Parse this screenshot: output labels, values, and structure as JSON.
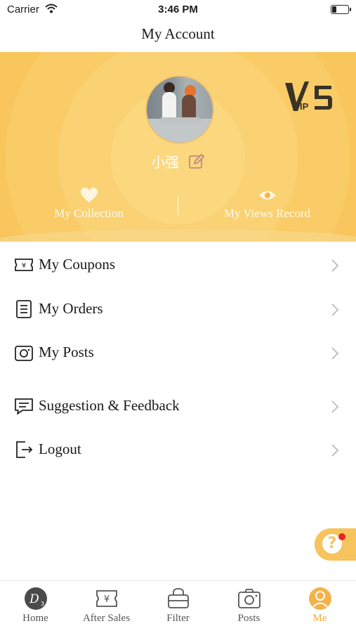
{
  "status_bar": {
    "carrier": "Carrier",
    "time": "3:46 PM"
  },
  "header": {
    "title": "My Account"
  },
  "profile": {
    "username": "小强",
    "vip_badge": "VIP5",
    "quick_links": [
      {
        "label": "My Collection",
        "icon": "heart-icon"
      },
      {
        "label": "My Views Record",
        "icon": "eye-icon"
      }
    ]
  },
  "menu": [
    {
      "label": "My Coupons",
      "icon": "coupon-icon"
    },
    {
      "label": "My Orders",
      "icon": "document-icon"
    },
    {
      "label": "My Posts",
      "icon": "camera-icon"
    },
    {
      "label": "Suggestion & Feedback",
      "icon": "chat-icon"
    },
    {
      "label": "Logout",
      "icon": "logout-icon"
    }
  ],
  "help": {
    "glyph": "?"
  },
  "tabbar": {
    "items": [
      {
        "label": "Home",
        "icon": "home-logo-icon"
      },
      {
        "label": "After Sales",
        "icon": "ticket-yen-icon"
      },
      {
        "label": "Filter",
        "icon": "bag-icon"
      },
      {
        "label": "Posts",
        "icon": "camera-icon"
      },
      {
        "label": "Me",
        "icon": "person-icon",
        "active": true
      }
    ]
  },
  "colors": {
    "accent": "#f1a93a",
    "hero": "#f9cc68",
    "badge": "#ee2222"
  }
}
